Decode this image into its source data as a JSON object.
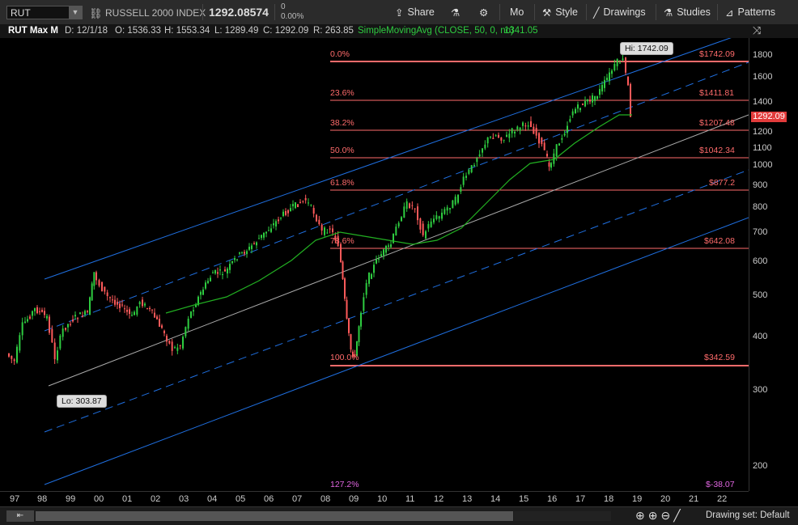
{
  "toolbar": {
    "symbol": "RUT",
    "name": "RUSSELL 2000 INDEX",
    "last": "1292.08574",
    "change_value": "0",
    "change_pct": "0.00%",
    "share_label": "Share",
    "aggregation_label": "Mo",
    "style_label": "Style",
    "drawings_label": "Drawings",
    "studies_label": "Studies",
    "patterns_label": "Patterns"
  },
  "info": {
    "title": "RUT Max M",
    "date": "D: 12/1/18",
    "open": "O: 1536.33",
    "high": "H: 1553.34",
    "low": "L: 1289.49",
    "close": "C: 1292.09",
    "range": "R: 263.85",
    "study": "SimpleMovingAvg (CLOSE, 50, 0, no)",
    "study_value": "1341.05"
  },
  "yaxis": {
    "ticks": [
      "1800",
      "1600",
      "1400",
      "1200",
      "1100",
      "1000",
      "900",
      "800",
      "700",
      "600",
      "500",
      "400",
      "300",
      "200"
    ],
    "last_price": "1292.09"
  },
  "xaxis": {
    "ticks": [
      "97",
      "98",
      "99",
      "00",
      "01",
      "02",
      "03",
      "04",
      "05",
      "06",
      "07",
      "08",
      "09",
      "10",
      "11",
      "12",
      "13",
      "14",
      "15",
      "16",
      "17",
      "18",
      "19",
      "20",
      "21",
      "22"
    ]
  },
  "fib": [
    {
      "pct": "0.0%",
      "price": "$1742.09"
    },
    {
      "pct": "23.6%",
      "price": "$1411.81"
    },
    {
      "pct": "38.2%",
      "price": "$1207.48"
    },
    {
      "pct": "50.0%",
      "price": "$1042.34"
    },
    {
      "pct": "61.8%",
      "price": "$877.2"
    },
    {
      "pct": "78.6%",
      "price": "$642.08"
    },
    {
      "pct": "100.0%",
      "price": "$342.59"
    },
    {
      "pct": "127.2%",
      "price": "$-38.07"
    }
  ],
  "callouts": {
    "hi": "Hi: 1742.09",
    "lo": "Lo: 303.87"
  },
  "bottom": {
    "drawing_set": "Drawing set: Default"
  },
  "colors": {
    "up": "#2ecc40",
    "down": "#ff5a5a",
    "fib": "#ff6b6b",
    "channel": "#1f6fe0",
    "sma": "#22b022",
    "mid": "#aaaaaa"
  }
}
